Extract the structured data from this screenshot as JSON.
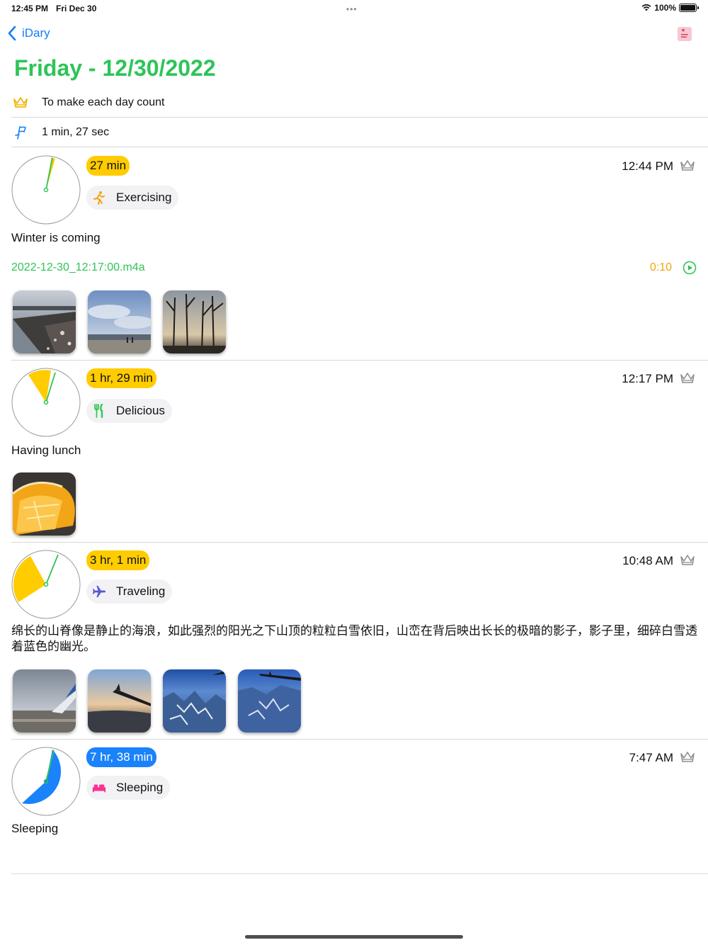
{
  "status_bar": {
    "time": "12:45 PM",
    "date": "Fri Dec 30",
    "battery": "100%"
  },
  "nav": {
    "back_label": "iDary"
  },
  "title": "Friday - 12/30/2022",
  "info": {
    "motto": "To make each day count",
    "duration": "1 min, 27 sec"
  },
  "entries": [
    {
      "duration_badge": "27 min",
      "badge_color": "#ffcc00",
      "tag": "Exercising",
      "tag_icon": "running-icon",
      "time": "12:44 PM",
      "note": "Winter is coming",
      "audio": {
        "file": "2022-12-30_12:17:00.m4a",
        "length": "0:10"
      },
      "photos": [
        "rocky-shore-photo",
        "beach-cloudy-sky-photo",
        "bare-trees-sunset-photo"
      ]
    },
    {
      "duration_badge": "1 hr, 29 min",
      "badge_color": "#ffcc00",
      "tag": "Delicious",
      "tag_icon": "fork-knife-icon",
      "time": "12:17 PM",
      "note": "Having lunch",
      "photos": [
        "orange-slices-photo"
      ]
    },
    {
      "duration_badge": "3 hr, 1 min",
      "badge_color": "#ffcc00",
      "tag": "Traveling",
      "tag_icon": "airplane-icon",
      "time": "10:48 AM",
      "note": "绵长的山脊像是静止的海浪，如此强烈的阳光之下山顶的粒粒白雪依旧，山峦在背后映出长长的极暗的影子，影子里，细碎白雪透着蓝色的幽光。",
      "photos": [
        "airport-tarmac-wing-photo",
        "wing-sunset-photo",
        "snowy-mountains-aerial-photo",
        "mountains-wing-aerial-photo"
      ]
    },
    {
      "duration_badge": "7 hr, 38 min",
      "badge_color": "#1a82fb",
      "tag": "Sleeping",
      "tag_icon": "bed-icon",
      "time": "7:47 AM",
      "note": "Sleeping"
    }
  ],
  "colors": {
    "accent_green": "#2ec458",
    "link_blue": "#147efb",
    "badge_yellow": "#ffcc00",
    "badge_blue": "#1a82fb",
    "audio_orange": "#f2a40b"
  }
}
